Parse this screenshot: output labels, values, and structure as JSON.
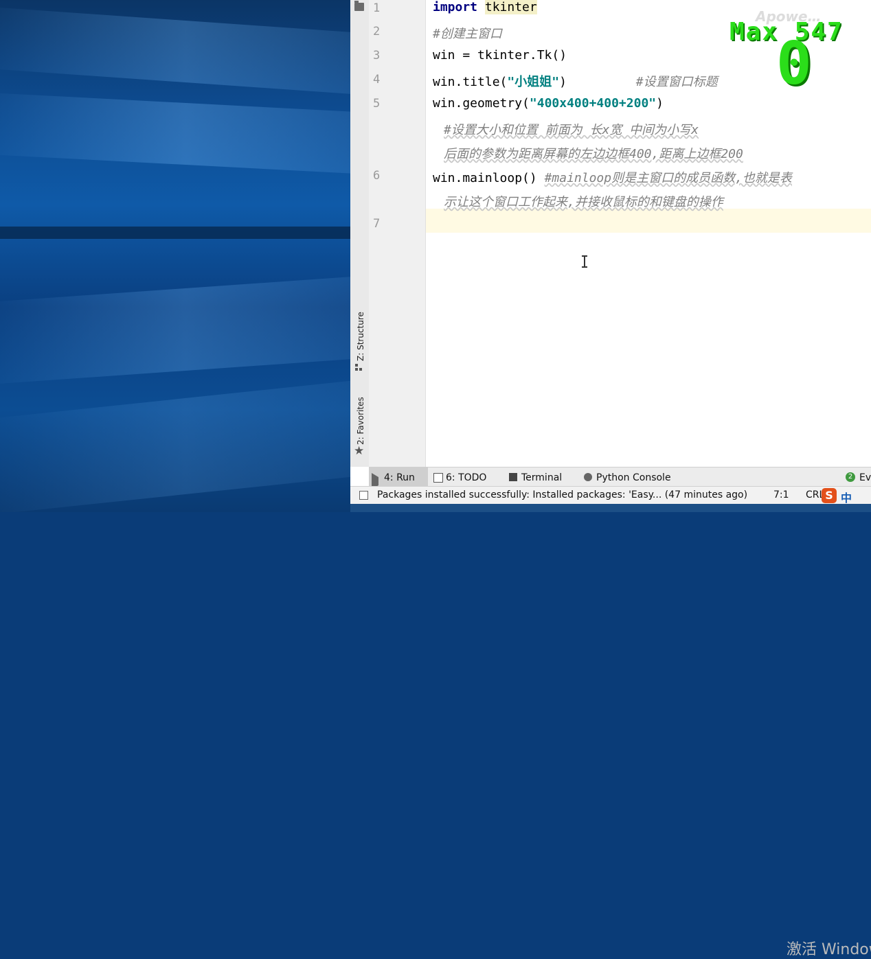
{
  "editor": {
    "line_numbers": [
      "1",
      "2",
      "3",
      "4",
      "5",
      "6",
      "7"
    ],
    "lines": {
      "l1_kw": "import",
      "l1_mod": "tkinter",
      "l2_cmt": "#创建主窗口",
      "l3": "win = tkinter.Tk()",
      "l4_pre": "win.title(",
      "l4_str": "\"小姐姐\"",
      "l4_post": ")",
      "l4_cmt": "#设置窗口标题",
      "l5_pre": "win.geometry(",
      "l5_str": "\"400x400+400+200\"",
      "l5_post": ")",
      "l5_cmt_a": "#设置大小和位置 前面为 长x宽 中间为小写x",
      "l5_cmt_b": "后面的参数为距离屏幕的左边边框400,距离上边框200",
      "l6_code": "win.mainloop()",
      "l6_cmt_a": "#mainloop则是主窗口的成员函数,也就是表",
      "l6_cmt_b": "示让这个窗口工作起来,并接收鼠标的和键盘的操作"
    }
  },
  "overlay": {
    "max_label": "Max 547",
    "score": "0",
    "watermark": "Apowe…"
  },
  "side_tabs": {
    "structure": "Z: Structure",
    "favorites": "2: Favorites"
  },
  "toolbar": {
    "run": "4: Run",
    "todo": "6: TODO",
    "terminal": "Terminal",
    "python_console": "Python Console",
    "event_log_badge": "2",
    "event_log": "Eve"
  },
  "status": {
    "message": "Packages installed successfully: Installed packages: 'Easy... (47 minutes ago)",
    "position": "7:1",
    "line_sep": "CRL",
    "ime_icon": "S",
    "ime_lang": "中",
    "activate_watermark": "激活 Window"
  },
  "colors": {
    "keyword": "#000080",
    "string": "#008080",
    "comment": "#808080",
    "overlay_green": "#2bde1a"
  }
}
